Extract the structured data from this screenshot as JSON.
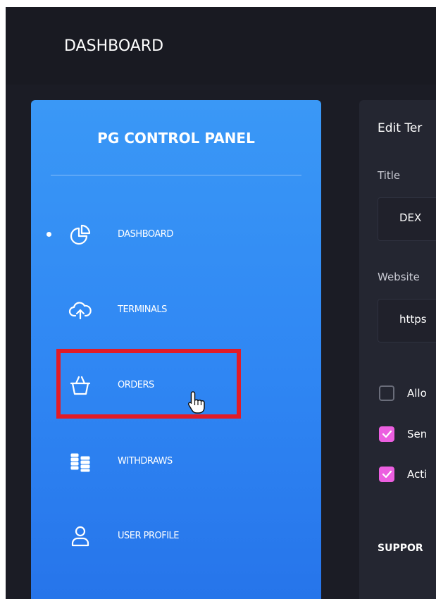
{
  "header": {
    "title": "DASHBOARD"
  },
  "sidebar": {
    "title": "PG CONTROL PANEL",
    "items": [
      {
        "label": "DASHBOARD",
        "icon": "pie-chart-icon",
        "active": true
      },
      {
        "label": "TERMINALS",
        "icon": "cloud-upload-icon",
        "active": false
      },
      {
        "label": "ORDERS",
        "icon": "basket-icon",
        "active": false,
        "highlighted": true
      },
      {
        "label": "WITHDRAWS",
        "icon": "coins-icon",
        "active": false
      },
      {
        "label": "USER PROFILE",
        "icon": "user-icon",
        "active": false
      }
    ]
  },
  "panel": {
    "title": "Edit Ter",
    "title_field": {
      "label": "Title",
      "value": "DEX"
    },
    "website_field": {
      "label": "Website",
      "value": "https"
    },
    "checkboxes": [
      {
        "label": "Allo",
        "checked": false
      },
      {
        "label": "Sen",
        "checked": true
      },
      {
        "label": "Acti",
        "checked": true
      }
    ],
    "support_label": "SUPPOR"
  },
  "colors": {
    "accent_blue": "#2f86f3",
    "highlight_red": "#e21b26",
    "checkbox_pink": "#ec5fe0",
    "background_dark": "#1b1c25"
  }
}
